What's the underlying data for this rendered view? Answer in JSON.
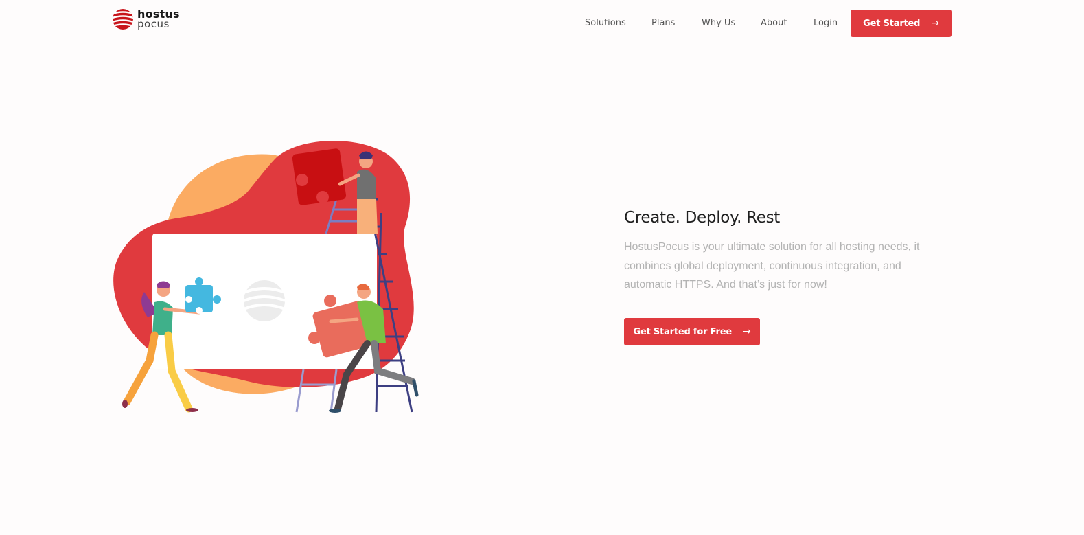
{
  "brand": {
    "name_line1": "hostus",
    "name_line2": "pocus",
    "accent_color": "#e03a3e"
  },
  "nav": {
    "items": [
      {
        "label": "Solutions"
      },
      {
        "label": "Plans"
      },
      {
        "label": "Why Us"
      },
      {
        "label": "About"
      },
      {
        "label": "Login"
      }
    ],
    "cta_label": "Get Started",
    "cta_icon": "arrow-right-icon"
  },
  "hero": {
    "title": "Create. Deploy. Rest",
    "description": "HostusPocus is your ultimate solution for all hosting needs, it combines global deployment, continuous integration, and automatic HTTPS. And that’s just for now!",
    "cta_label": "Get Started for Free",
    "cta_icon": "arrow-right-icon",
    "illustration": "team-assembling-puzzle-illustration"
  }
}
